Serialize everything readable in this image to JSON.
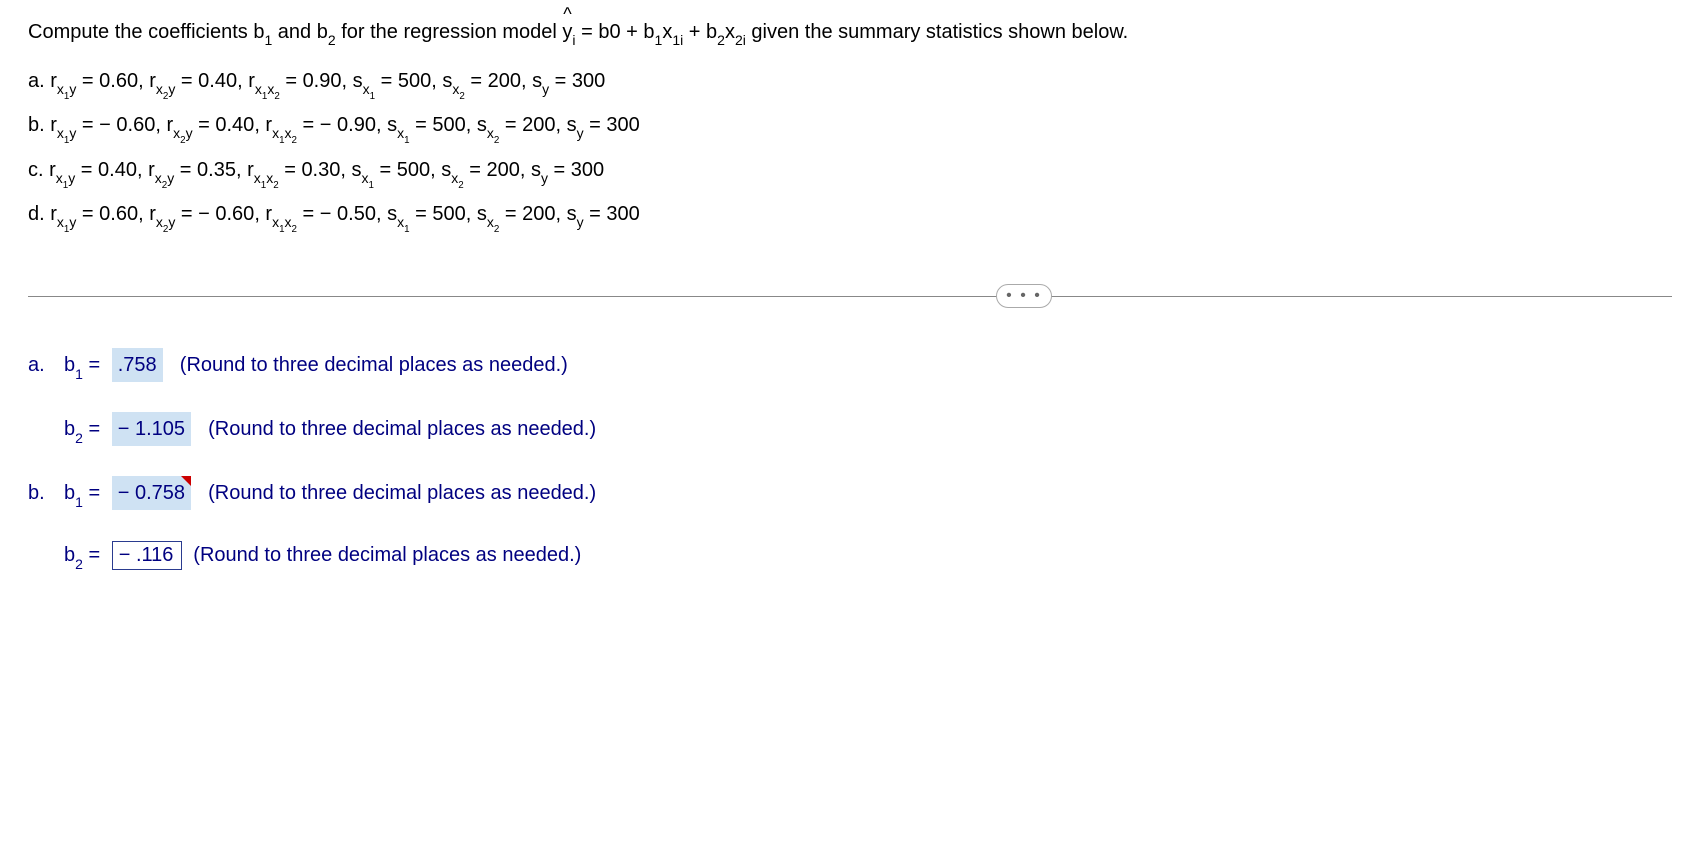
{
  "question": {
    "prefix": "Compute the coefficients b",
    "mid1": " and b",
    "mid2": " for the regression model ",
    "yhat": "y",
    "eq_i": "i",
    "eq_rhs1": " = b0 + b",
    "eq_rhs2": "x",
    "eq_1i": "1i",
    "eq_plus": " + b",
    "eq_rhs3": "x",
    "eq_2i": "2i",
    "suffix": " given the summary statistics shown below."
  },
  "options": {
    "a": {
      "label": "a. ",
      "rx1y": "0.60",
      "rx2y": "0.40",
      "rx1x2": "0.90",
      "sx1": "500",
      "sx2": "200",
      "sy": "300"
    },
    "b": {
      "label": "b. ",
      "rx1y": "− 0.60",
      "rx2y": "0.40",
      "rx1x2": "− 0.90",
      "sx1": "500",
      "sx2": "200",
      "sy": "300"
    },
    "c": {
      "label": "c. ",
      "rx1y": "0.40",
      "rx2y": "0.35",
      "rx1x2": "0.30",
      "sx1": "500",
      "sx2": "200",
      "sy": "300"
    },
    "d": {
      "label": "d. ",
      "rx1y": "0.60",
      "rx2y": "− 0.60",
      "rx1x2": "− 0.50",
      "sx1": "500",
      "sx2": "200",
      "sy": "300"
    }
  },
  "more": "• • •",
  "answers": {
    "hint": "(Round to three decimal places as needed.)",
    "a": {
      "prefix": "a.",
      "b1_label": "b",
      "eq": " = ",
      "b1_val": ".758",
      "b2_val": "− 1.105"
    },
    "b": {
      "prefix": "b.",
      "b1_val": "− 0.758",
      "b2_val": "− .116"
    }
  }
}
